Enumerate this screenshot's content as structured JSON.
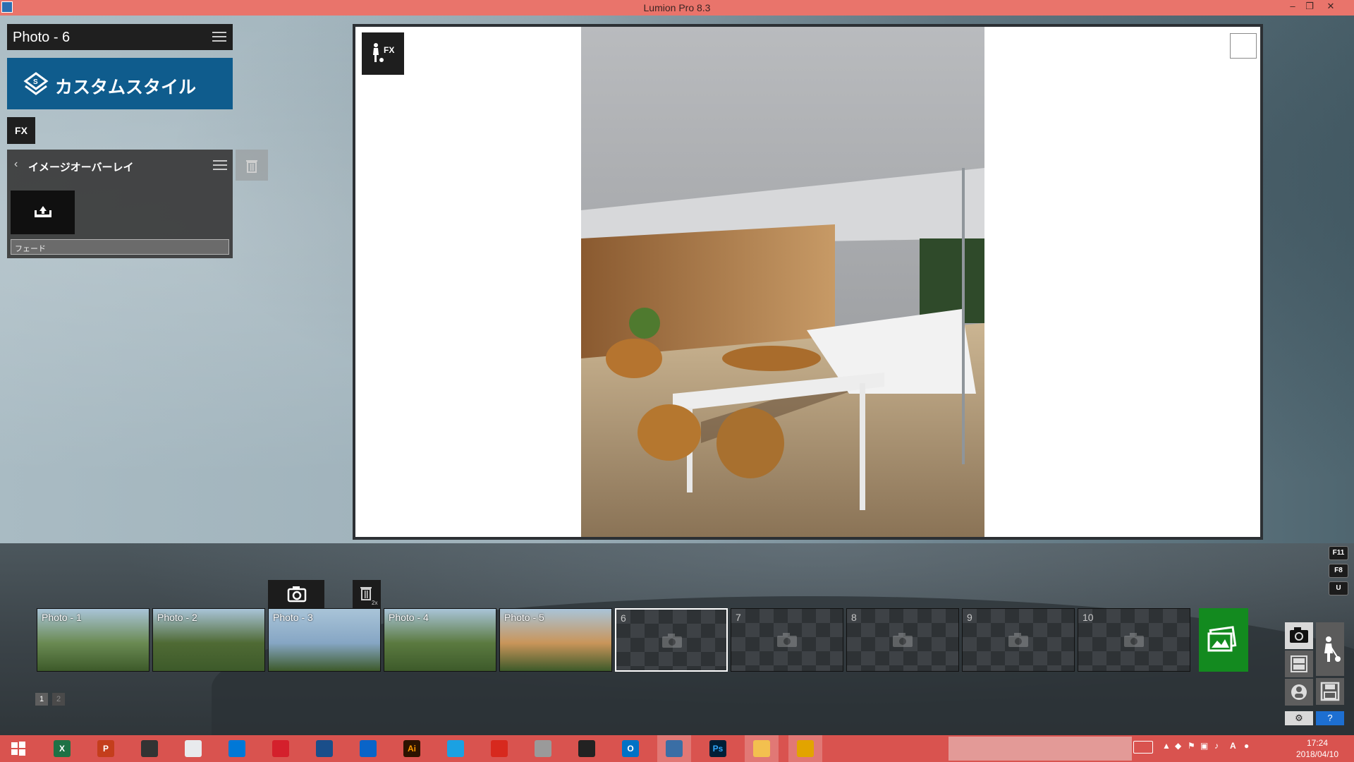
{
  "window": {
    "title": "Lumion Pro 8.3",
    "controls": [
      "–",
      "❐",
      "✕"
    ]
  },
  "left_panel": {
    "photo_title": "Photo - 6",
    "style_banner": "カスタムスタイル",
    "fx_tab": "FX",
    "effect": {
      "title": "イメージオーバーレイ",
      "fade_label": "フェード"
    }
  },
  "preview": {
    "fx_button_label": "FX"
  },
  "key_hints": [
    "F11",
    "F8",
    "U"
  ],
  "filmstrip": {
    "photos": [
      {
        "label": "Photo - 1",
        "kind": "photo"
      },
      {
        "label": "Photo - 2",
        "kind": "photo"
      },
      {
        "label": "Photo - 3",
        "kind": "photo"
      },
      {
        "label": "Photo - 4",
        "kind": "photo"
      },
      {
        "label": "Photo - 5",
        "kind": "photo"
      },
      {
        "label": "6",
        "kind": "empty",
        "selected": true
      },
      {
        "label": "7",
        "kind": "empty"
      },
      {
        "label": "8",
        "kind": "empty"
      },
      {
        "label": "9",
        "kind": "empty"
      },
      {
        "label": "10",
        "kind": "empty"
      }
    ],
    "pages": [
      "1",
      "2"
    ],
    "trash_badge": "2x"
  },
  "mode_panel": {
    "settings_label": "⚙",
    "help_label": "?"
  },
  "taskbar": {
    "apps": [
      "start",
      "excel",
      "powerpoint",
      "cloud-app",
      "chrome",
      "mail",
      "creative-cloud",
      "1password",
      "onedrive",
      "illustrator",
      "internet-explorer",
      "sketchup",
      "plotter-app",
      "nvidia-app",
      "outlook",
      "lumion",
      "photoshop",
      "file-explorer",
      "zip-app"
    ],
    "app_labels": {
      "illustrator": "Ai",
      "photoshop": "Ps",
      "excel": "X",
      "powerpoint": "P",
      "outlook": "O"
    },
    "ime": "A",
    "time": "17:24",
    "date": "2018/04/10"
  },
  "colors": {
    "titlebar": "#e9746b",
    "style_banner": "#0f5c8d",
    "taskbar": "#d9534f",
    "green_button": "#138a1f"
  }
}
